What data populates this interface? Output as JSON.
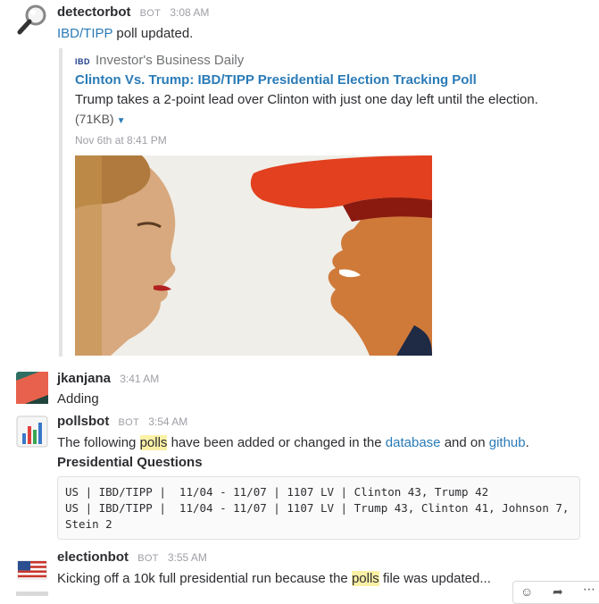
{
  "messages": {
    "detectorbot": {
      "name": "detectorbot",
      "bot_tag": "BOT",
      "time": "3:08 AM",
      "link_text": "IBD/TIPP",
      "text_rest": " poll updated.",
      "avatar_icon": "magnifying-glass-icon",
      "attachment": {
        "favicon_text": "IBD",
        "source": "Investor's Business Daily",
        "title": "Clinton Vs. Trump: IBD/TIPP Presidential Election Tracking Poll",
        "description": "Trump takes a 2-point lead over Clinton with just one day left until the election.",
        "size": "(71KB)",
        "date": "Nov 6th at 8:41 PM"
      }
    },
    "jkanjana": {
      "name": "jkanjana",
      "time": "3:41 AM",
      "text": "Adding"
    },
    "pollsbot": {
      "name": "pollsbot",
      "bot_tag": "BOT",
      "time": "3:54 AM",
      "avatar_icon": "bar-chart-icon",
      "line1_a": "The following ",
      "line1_hl": "polls",
      "line1_b": " have been added or changed in the ",
      "line1_link1": "database",
      "line1_c": " and on ",
      "line1_link2": "github",
      "line1_d": ".",
      "heading": "Presidential Questions",
      "code_lines": [
        "US | IBD/TIPP |  11/04 - 11/07 | 1107 LV | Clinton 43, Trump 42",
        "US | IBD/TIPP |  11/04 - 11/07 | 1107 LV | Trump 43, Clinton 41, Johnson 7,",
        "Stein 2"
      ]
    },
    "electionbot": {
      "name": "electionbot",
      "bot_tag": "BOT",
      "time": "3:55 AM",
      "avatar_icon": "us-flag-icon",
      "text_a": "Kicking off a 10k full presidential run because the ",
      "text_hl": "polls",
      "text_b": " file was updated..."
    }
  },
  "colors": {
    "link": "#2a7bb7",
    "highlight": "#fbf1a6",
    "muted": "#9e9ea6",
    "text": "#2c2d30"
  }
}
